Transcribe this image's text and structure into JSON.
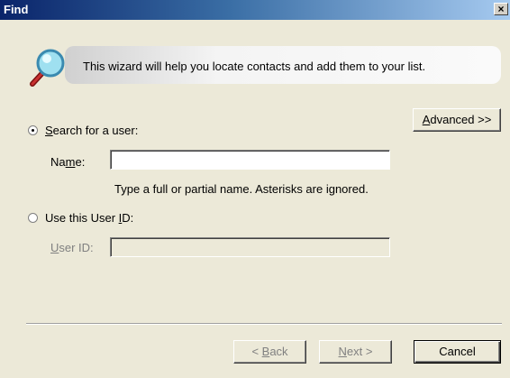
{
  "window": {
    "title": "Find",
    "close_glyph": "×"
  },
  "banner": {
    "icon": "magnifier-icon",
    "text": "This wizard will help you locate contacts and add them to your list."
  },
  "advanced_button": {
    "label_ul": "A",
    "label_rest": "dvanced >>"
  },
  "search_user": {
    "radio_selected": true,
    "label_ul": "S",
    "label_rest": "earch for a user:",
    "name_label_pre": "Na",
    "name_label_ul": "m",
    "name_label_post": "e:",
    "name_value": "",
    "hint": "Type a full or partial name.  Asterisks are ignored."
  },
  "user_id_option": {
    "radio_selected": false,
    "label_pre": "Use this User ",
    "label_ul": "I",
    "label_post": "D:",
    "field_label_ul": "U",
    "field_label_rest": "ser ID:",
    "value": ""
  },
  "footer": {
    "back_pre": "< ",
    "back_ul": "B",
    "back_post": "ack",
    "next_ul": "N",
    "next_post": "ext >",
    "cancel": "Cancel"
  },
  "colors": {
    "titlebar_start": "#0a246a",
    "titlebar_end": "#a6caf0",
    "dialog_bg": "#ece9d8"
  }
}
